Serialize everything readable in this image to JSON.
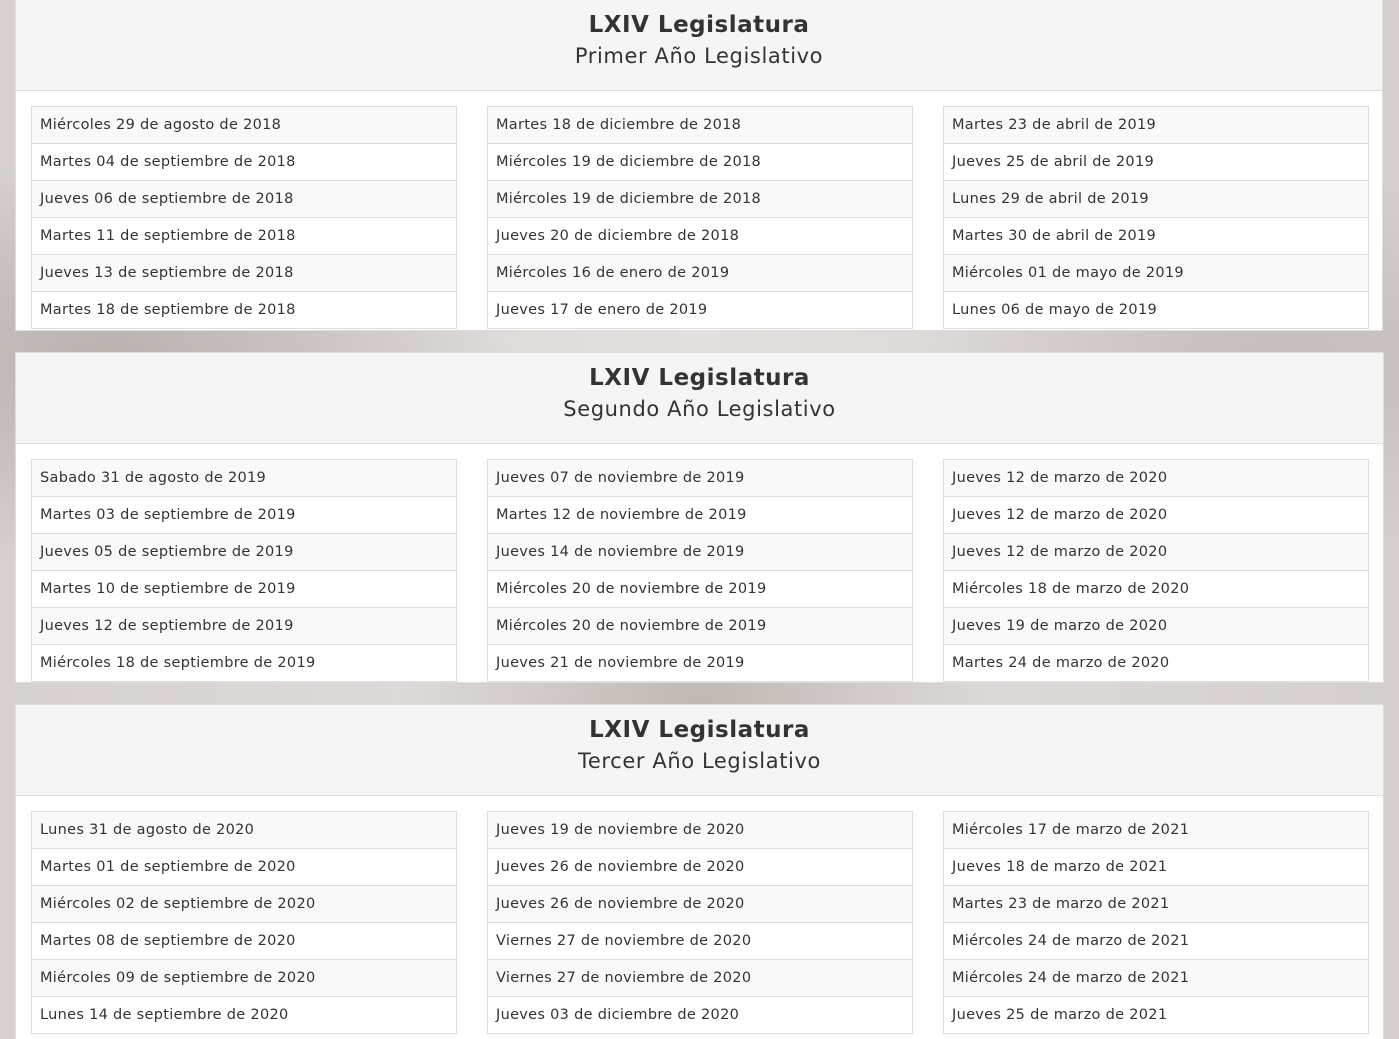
{
  "sections": [
    {
      "title": "LXIV Legislatura",
      "subtitle": "Primer Año Legislativo",
      "columns": [
        [
          "Miércoles 29 de agosto de 2018",
          "Martes 04 de septiembre de 2018",
          "Jueves 06 de septiembre de 2018",
          "Martes 11 de septiembre de 2018",
          "Jueves 13 de septiembre de 2018",
          "Martes 18 de septiembre de 2018"
        ],
        [
          "Martes 18 de diciembre de 2018",
          "Miércoles 19 de diciembre de 2018",
          "Miércoles 19 de diciembre de 2018",
          "Jueves 20 de diciembre de 2018",
          "Miércoles 16 de enero de 2019",
          "Jueves 17 de enero de 2019"
        ],
        [
          "Martes 23 de abril de 2019",
          "Jueves 25 de abril de 2019",
          "Lunes 29 de abril de 2019",
          "Martes 30 de abril de 2019",
          "Miércoles 01 de mayo de 2019",
          "Lunes 06 de mayo de 2019"
        ]
      ]
    },
    {
      "title": "LXIV Legislatura",
      "subtitle": "Segundo Año Legislativo",
      "columns": [
        [
          "Sabado 31 de agosto de 2019",
          "Martes 03 de septiembre de 2019",
          "Jueves 05 de septiembre de 2019",
          "Martes 10 de septiembre de 2019",
          "Jueves 12 de septiembre de 2019",
          "Miércoles 18 de septiembre de 2019"
        ],
        [
          "Jueves 07 de noviembre de 2019",
          "Martes 12 de noviembre de 2019",
          "Jueves 14 de noviembre de 2019",
          "Miércoles 20 de noviembre de 2019",
          "Miércoles 20 de noviembre de 2019",
          "Jueves 21 de noviembre de 2019"
        ],
        [
          "Jueves 12 de marzo de 2020",
          "Jueves 12 de marzo de 2020",
          "Jueves 12 de marzo de 2020",
          "Miércoles 18 de marzo de 2020",
          "Jueves 19 de marzo de 2020",
          "Martes 24 de marzo de 2020"
        ]
      ]
    },
    {
      "title": "LXIV Legislatura",
      "subtitle": "Tercer Año Legislativo",
      "columns": [
        [
          "Lunes 31 de agosto de 2020",
          "Martes 01 de septiembre de 2020",
          "Miércoles 02 de septiembre de 2020",
          "Martes 08 de septiembre de 2020",
          "Miércoles 09 de septiembre de 2020",
          "Lunes 14 de septiembre de 2020"
        ],
        [
          "Jueves 19 de noviembre de 2020",
          "Jueves 26 de noviembre de 2020",
          "Jueves 26 de noviembre de 2020",
          "Viernes 27 de noviembre de 2020",
          "Viernes 27 de noviembre de 2020",
          "Jueves 03 de diciembre de 2020"
        ],
        [
          "Miércoles 17 de marzo de 2021",
          "Jueves 18 de marzo de 2021",
          "Martes 23 de marzo de 2021",
          "Miércoles 24 de marzo de 2021",
          "Miércoles 24 de marzo de 2021",
          "Jueves 25 de marzo de 2021"
        ]
      ]
    }
  ]
}
